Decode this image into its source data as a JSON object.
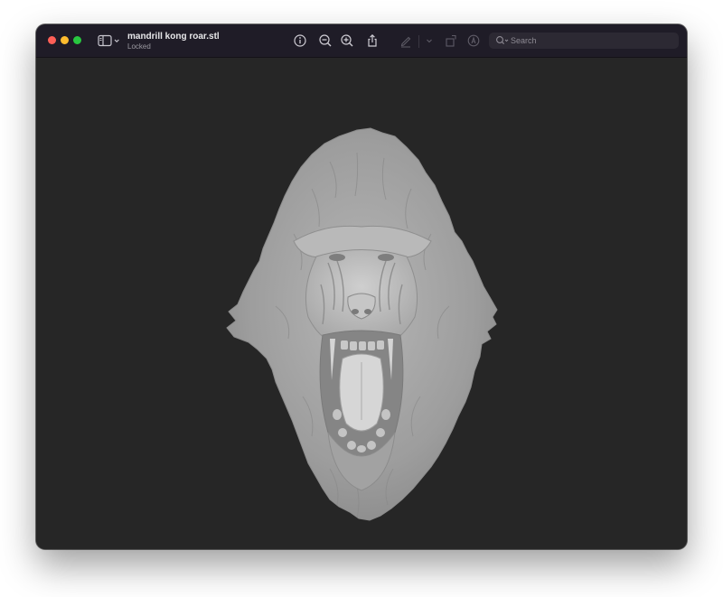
{
  "window": {
    "title": "mandrill kong roar.stl",
    "subtitle": "Locked"
  },
  "toolbar": {
    "traffic_lights": [
      "close",
      "minimize",
      "zoom"
    ],
    "buttons": [
      {
        "name": "info",
        "icon": "info-circle-icon"
      },
      {
        "name": "zoom-out",
        "icon": "zoom-out-icon"
      },
      {
        "name": "zoom-in",
        "icon": "zoom-in-icon"
      },
      {
        "name": "share",
        "icon": "share-icon"
      },
      {
        "name": "markup",
        "icon": "pen-icon"
      },
      {
        "name": "markup-menu",
        "icon": "chevron-down-icon"
      },
      {
        "name": "rotate",
        "icon": "rotate-icon"
      },
      {
        "name": "annotate",
        "icon": "annotate-circle-icon"
      }
    ]
  },
  "search": {
    "placeholder": "Search",
    "value": ""
  },
  "colors": {
    "titlebar": "#1f1c27",
    "viewport": "#262626",
    "model": "#a3a3a3",
    "close": "#fe5f57",
    "minimize": "#febc2e",
    "zoom": "#28c840"
  },
  "viewer": {
    "model_name": "3d-model-mandrill-head"
  }
}
